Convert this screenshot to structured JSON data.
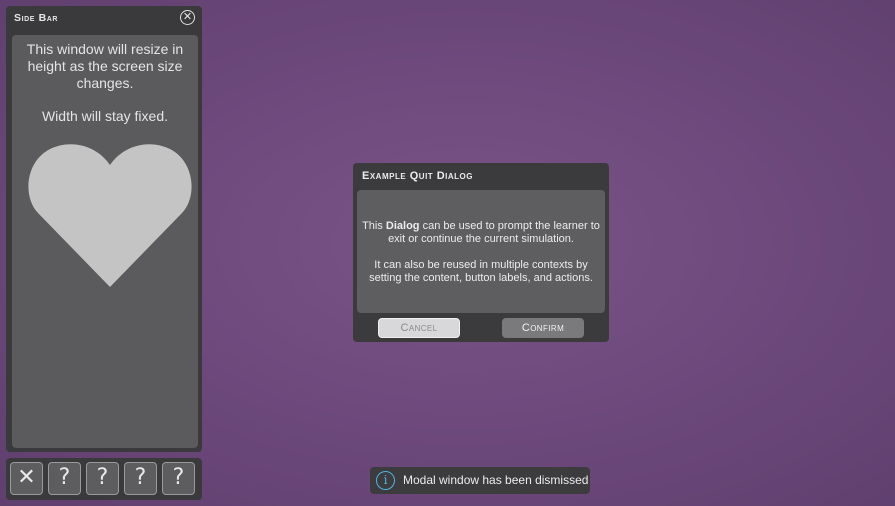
{
  "sidebar": {
    "title": "Side Bar",
    "close_icon": "close-circle-icon",
    "text_resize": "This window will resize in height as the screen size changes.",
    "text_width": "Width will stay fixed.",
    "heart_color": "#c4c4c4"
  },
  "toolbar": {
    "buttons": [
      {
        "label": "✕",
        "icon": "close-icon"
      },
      {
        "label": "?",
        "icon": "help-icon"
      },
      {
        "label": "?",
        "icon": "help-icon"
      },
      {
        "label": "?",
        "icon": "help-icon"
      },
      {
        "label": "?",
        "icon": "help-icon"
      }
    ]
  },
  "dialog": {
    "title": "Example Quit Dialog",
    "para1_pre": "This ",
    "para1_bold": "Dialog",
    "para1_post": " can be used to prompt the learner to exit or continue the current simulation.",
    "para2": "It can also be reused in multiple contexts by setting the content, button labels, and actions.",
    "cancel_label": "Cancel",
    "confirm_label": "Confirm"
  },
  "toast": {
    "icon": "info-icon",
    "icon_glyph": "i",
    "message": "Modal window has been dismissed",
    "accent": "#4fb3e8"
  }
}
